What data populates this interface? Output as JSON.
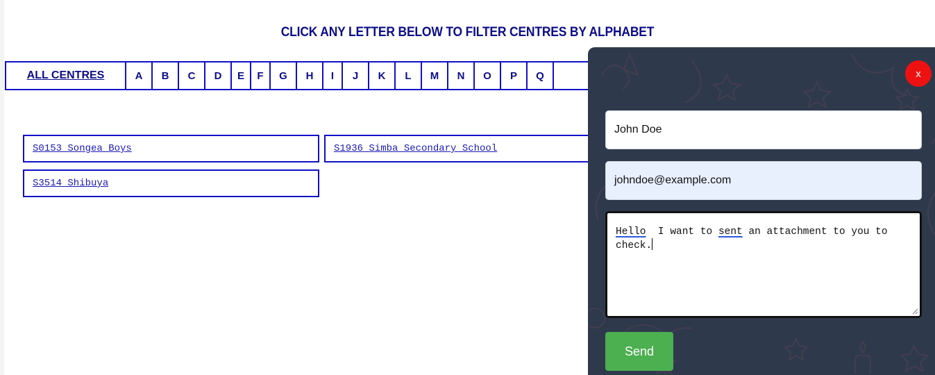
{
  "heading": "CLICK ANY LETTER BELOW TO FILTER CENTRES BY ALPHABET",
  "alphabet": {
    "all_label": "ALL CENTRES",
    "letters": [
      "A",
      "B",
      "C",
      "D",
      "E",
      "F",
      "G",
      "H",
      "I",
      "J",
      "K",
      "L",
      "M",
      "N",
      "O",
      "P",
      "Q"
    ]
  },
  "centres": [
    {
      "label": "S0153 Songea Boys"
    },
    {
      "label": "S1936 Simba Secondary School"
    },
    {
      "label": "S3514 Shibuya"
    }
  ],
  "chat": {
    "close_label": "x",
    "name_value": "John Doe",
    "email_value": "johndoe@example.com",
    "message": {
      "word1": "Hello",
      "part2": "  I want to ",
      "word2": "sent",
      "part3": " an attachment to you to check."
    },
    "send_label": "Send"
  },
  "colors": {
    "navy_text": "#0d0d8a",
    "link_blue": "#1a1ab8",
    "border_blue": "#1010c8",
    "panel_bg": "#2e3a4b",
    "close_red": "#ee1111",
    "send_green": "#4caf50",
    "email_bg": "#e8f0fe"
  }
}
